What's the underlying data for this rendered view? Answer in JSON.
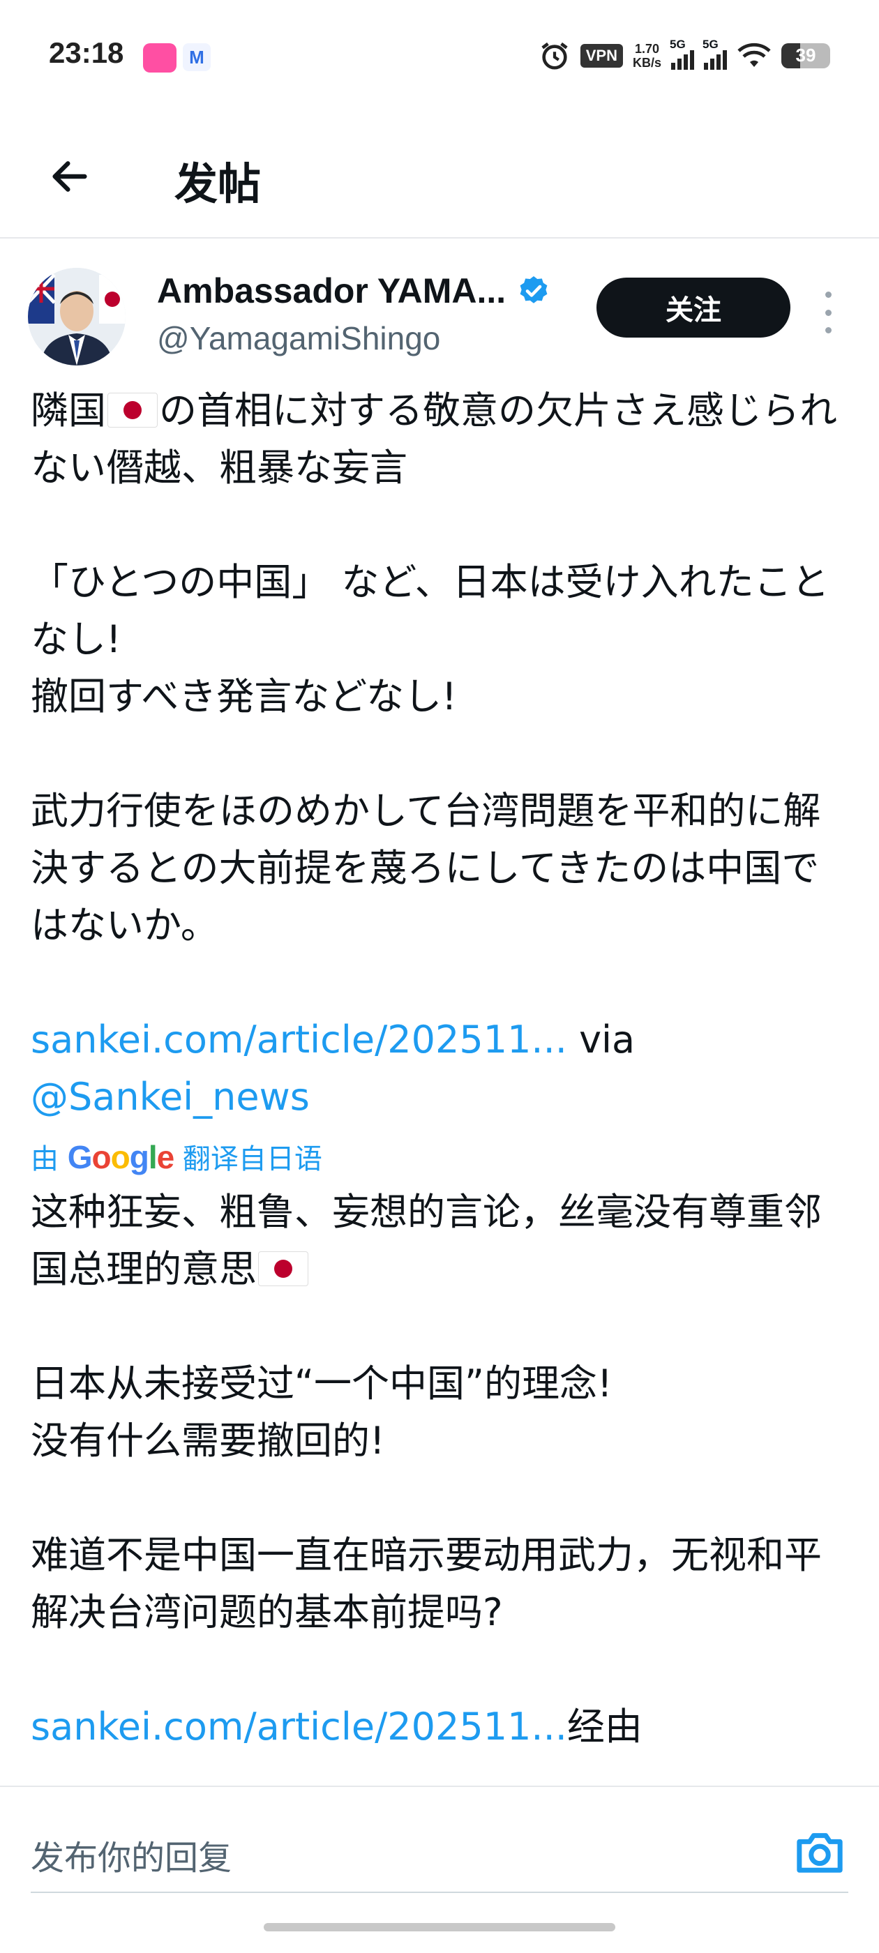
{
  "status_bar": {
    "time": "23:18",
    "speed_value": "1.70",
    "speed_unit": "KB/s",
    "vpn_label": "VPN",
    "network_1": "5G",
    "network_2": "5G",
    "battery": "39",
    "battery_level_percent": 39
  },
  "header": {
    "title": "发帖",
    "back_icon": "arrow-left-icon"
  },
  "author": {
    "name": "Ambassador YAMA...",
    "handle": "@YamagamiShingo",
    "verified_icon": "verified-badge-icon",
    "follow_label": "关注",
    "more_icon": "more-vertical-icon"
  },
  "post": {
    "p1_a": "隣国",
    "p1_b": "の首相に対する敬意の欠片さえ感じられない僭越、粗暴な妄言",
    "p2": "「ひとつの中国」 など、日本は受け入れたことなし!",
    "p3": "撤回すべき発言などなし!",
    "p4": "武力行使をほのめかして台湾問題を平和的に解決するとの大前提を蔑ろにしてきたのは中国ではないか。",
    "link1": "sankei.com/article/202511...",
    "via": " via",
    "mention": "@Sankei_news",
    "translate_prefix": "由",
    "translate_brand": "Google",
    "translate_suffix": "翻译自日语",
    "t1": "这种狂妄、粗鲁、妄想的言论，丝毫没有尊重邻国总理的意思",
    "t2": "日本从未接受过“一个中国”的理念!",
    "t3": "没有什么需要撤回的!",
    "t4": "难道不是中国一直在暗示要动用武力，无视和平解决台湾问题的基本前提吗?",
    "link2": "sankei.com/article/202511...",
    "via_translated": "经由"
  },
  "reply": {
    "placeholder": "发布你的回复",
    "camera_icon": "camera-icon"
  },
  "colors": {
    "link": "#1d9bf0",
    "follow_bg": "#0f1419",
    "text": "#0f1419",
    "secondary": "#536471"
  }
}
